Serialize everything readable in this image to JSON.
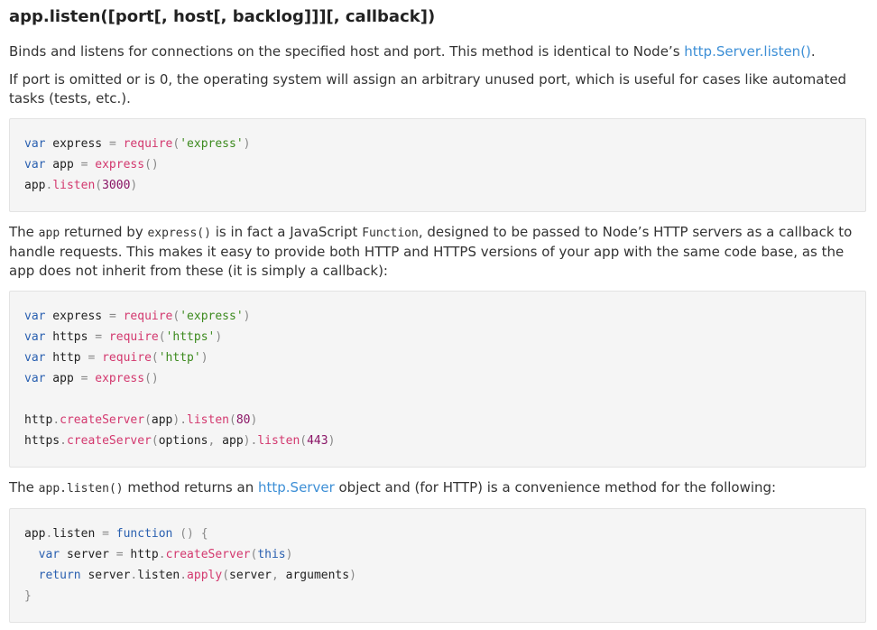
{
  "heading": "app.listen([port[, host[, backlog]]][, callback])",
  "para1": {
    "text_before": "Binds and listens for connections on the specified host and port. This method is identical to Node’s ",
    "link": "http.Server.listen()",
    "text_after": "."
  },
  "para2": "If port is omitted or is 0, the operating system will assign an arbitrary unused port, which is useful for cases like automated tasks (tests, etc.).",
  "para3": {
    "t1": "The ",
    "c1": "app",
    "t2": " returned by ",
    "c2": "express()",
    "t3": " is in fact a JavaScript ",
    "c3": "Function",
    "t4": ", designed to be passed to Node’s HTTP servers as a callback to handle requests. This makes it easy to provide both HTTP and HTTPS versions of your app with the same code base, as the app does not inherit from these (it is simply a callback):"
  },
  "para4": {
    "t1": "The ",
    "c1": "app.listen()",
    "t2": " method returns an ",
    "link": "http.Server",
    "t3": " object and (for HTTP) is a convenience method for the following:"
  },
  "code1": {
    "l1": {
      "k": "var",
      "id": " express ",
      "op": "=",
      "fn": " require",
      "p1": "(",
      "s": "'express'",
      "p2": ")"
    },
    "l2": {
      "k": "var",
      "id": " app ",
      "op": "=",
      "fn": " express",
      "p1": "()"
    },
    "l3": {
      "id": "app",
      "dot": ".",
      "fn": "listen",
      "p1": "(",
      "n": "3000",
      "p2": ")"
    }
  },
  "code2": {
    "l1": {
      "k": "var",
      "id": " express ",
      "op": "=",
      "fn": " require",
      "p1": "(",
      "s": "'express'",
      "p2": ")"
    },
    "l2": {
      "k": "var",
      "id": " https ",
      "op": "=",
      "fn": " require",
      "p1": "(",
      "s": "'https'",
      "p2": ")"
    },
    "l3": {
      "k": "var",
      "id": " http ",
      "op": "=",
      "fn": " require",
      "p1": "(",
      "s": "'http'",
      "p2": ")"
    },
    "l4": {
      "k": "var",
      "id": " app ",
      "op": "=",
      "fn": " express",
      "p1": "()"
    },
    "l5": {
      "id1": "http",
      "dot1": ".",
      "fn1": "createServer",
      "p1": "(",
      "id2": "app",
      "p2": ")",
      "dot2": ".",
      "fn2": "listen",
      "p3": "(",
      "n": "80",
      "p4": ")"
    },
    "l6": {
      "id1": "https",
      "dot1": ".",
      "fn1": "createServer",
      "p1": "(",
      "id2": "options",
      "comma": ", ",
      "id3": "app",
      "p2": ")",
      "dot2": ".",
      "fn2": "listen",
      "p3": "(",
      "n": "443",
      "p4": ")"
    }
  },
  "code3": {
    "l1": {
      "id": "app",
      "dot": ".",
      "id2": "listen ",
      "op": "=",
      "k": " function",
      "p": " () {"
    },
    "l2": {
      "ind": "  ",
      "k": "var",
      "id": " server ",
      "op": "=",
      "id2": " http",
      "dot": ".",
      "fn": "createServer",
      "p1": "(",
      "k2": "this",
      "p2": ")"
    },
    "l3": {
      "ind": "  ",
      "k": "return",
      "id": " server",
      "dot": ".",
      "id2": "listen",
      "dot2": ".",
      "fn": "apply",
      "p1": "(",
      "id3": "server",
      "comma": ", ",
      "id4": "arguments",
      "p2": ")"
    },
    "l4": {
      "p": "}"
    }
  }
}
